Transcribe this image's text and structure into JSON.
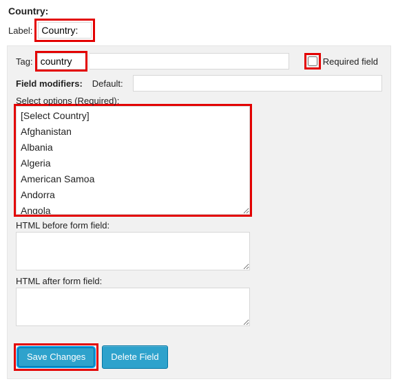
{
  "heading": "Country:",
  "label_row": {
    "label": "Label:",
    "value": "Country:"
  },
  "panel": {
    "tag": {
      "label": "Tag:",
      "value": "country"
    },
    "required": {
      "label": "Required field",
      "checked": false
    },
    "modifiers": {
      "label": "Field modifiers:",
      "default_label": "Default:",
      "default_value": ""
    },
    "select_options": {
      "label": "Select options (Required):",
      "options": [
        "[Select Country]",
        "Afghanistan",
        "Albania",
        "Algeria",
        "American Samoa",
        "Andorra",
        "Angola"
      ]
    },
    "html_before": {
      "label": "HTML before form field:",
      "value": ""
    },
    "html_after": {
      "label": "HTML after form field:",
      "value": ""
    },
    "buttons": {
      "save": "Save Changes",
      "delete": "Delete Field"
    }
  },
  "colors": {
    "accent": "#2ea2cc",
    "highlight": "#e30000"
  }
}
